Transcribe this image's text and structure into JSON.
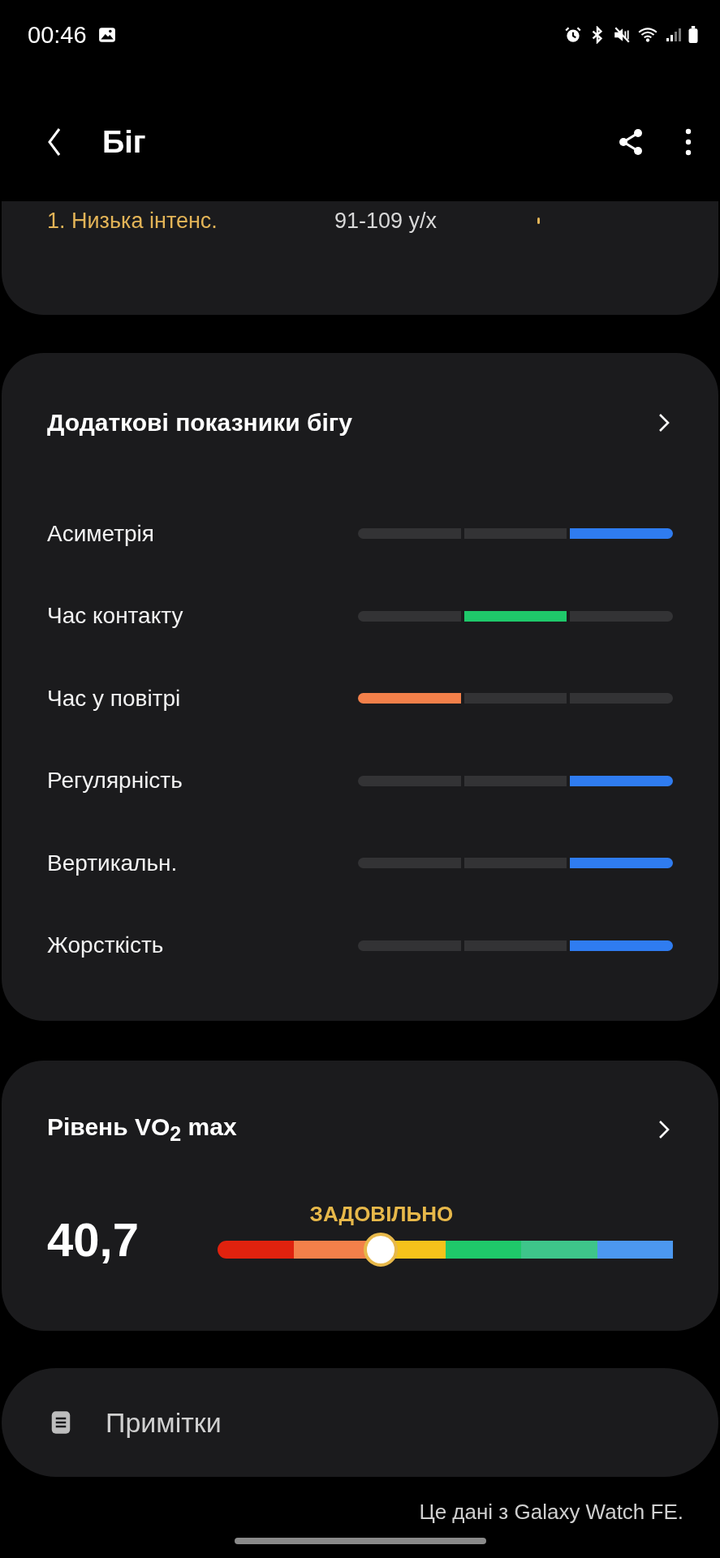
{
  "status_bar": {
    "time": "00:46"
  },
  "header": {
    "title": "Біг"
  },
  "zone_card": {
    "zone": {
      "label": "1. Низька інтенс.",
      "range": "91-109 у/х"
    }
  },
  "metrics_card": {
    "title": "Додаткові показники бігу",
    "metrics": [
      {
        "label": "Асиметрія",
        "color": "#2f7cf0",
        "segments": [
          {
            "selected": false
          },
          {
            "selected": false
          },
          {
            "selected": true
          }
        ]
      },
      {
        "label": "Час контакту",
        "color": "#1fc86a",
        "segments": [
          {
            "selected": false
          },
          {
            "selected": true
          },
          {
            "selected": false
          }
        ]
      },
      {
        "label": "Час у повітрі",
        "color": "#f3804a",
        "segments": [
          {
            "selected": true
          },
          {
            "selected": false
          },
          {
            "selected": false
          }
        ]
      },
      {
        "label": "Регулярність",
        "color": "#2f7cf0",
        "segments": [
          {
            "selected": false
          },
          {
            "selected": false
          },
          {
            "selected": true
          }
        ]
      },
      {
        "label": "Вертикальн.",
        "color": "#2f7cf0",
        "segments": [
          {
            "selected": false
          },
          {
            "selected": false
          },
          {
            "selected": true
          }
        ]
      },
      {
        "label": "Жорсткість",
        "color": "#2f7cf0",
        "segments": [
          {
            "selected": false
          },
          {
            "selected": false
          },
          {
            "selected": true
          }
        ]
      }
    ]
  },
  "vo2_card": {
    "title": "Рівень VO$_{2}$ max",
    "value": "40,7",
    "rating": "ЗАДОВІЛЬНО"
  },
  "notes": {
    "label": "Примітки"
  },
  "footer": "Це дані з Galaxy Watch FE."
}
